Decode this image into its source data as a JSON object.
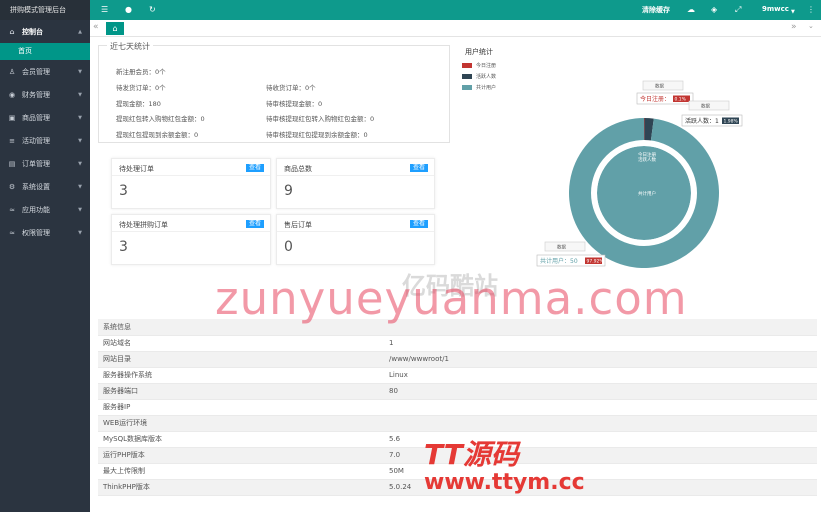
{
  "brand": "拼购模式管理后台",
  "colors": {
    "accent": "#009688",
    "header": "#0e9a8c",
    "sidebar": "#2b3440",
    "button": "#1e9fff"
  },
  "sidebar": {
    "items": [
      {
        "icon": "home-icon",
        "label": "控制台",
        "active": true
      },
      {
        "icon": "user-icon",
        "label": "会员管理"
      },
      {
        "icon": "finance-icon",
        "label": "财务管理"
      },
      {
        "icon": "goods-icon",
        "label": "商品管理"
      },
      {
        "icon": "activity-icon",
        "label": "活动管理"
      },
      {
        "icon": "order-icon",
        "label": "订单管理"
      },
      {
        "icon": "gear-icon",
        "label": "系统设置"
      },
      {
        "icon": "app-icon",
        "label": "应用功能"
      },
      {
        "icon": "permission-icon",
        "label": "权限管理"
      }
    ],
    "sub_active": "首页"
  },
  "header": {
    "clear_cache": "清除缓存",
    "user": "9mwcc"
  },
  "stats": {
    "legend": "近七天统计",
    "new_members": "新注册会员：0个",
    "pending_ship": "待发货订单：0个",
    "pending_receive": "待收货订单：0个",
    "withdraw_amount": "提现金额：180",
    "pending_withdraw": "待审核提现金额：0",
    "withdraw_redbag": "提现红包转入购物红包金额：0",
    "pending_withdraw_redbag": "待审核提现红包转入购物红包金额：0",
    "withdraw_redbag_balance": "提现红包提现到余额金额：0",
    "pending_withdraw_redbag_balance": "待审核提现红包提现到余额金额：0"
  },
  "cards": [
    {
      "title": "待处理订单",
      "btn": "查看",
      "value": "3"
    },
    {
      "title": "商品总数",
      "btn": "查看",
      "value": "9"
    },
    {
      "title": "待处理拼购订单",
      "btn": "查看",
      "value": "3"
    },
    {
      "title": "售后订单",
      "btn": "查看",
      "value": "0"
    }
  ],
  "chart_data": {
    "type": "pie",
    "title": "用户统计",
    "legend_position": "top-left",
    "series": [
      {
        "name": "今日注册",
        "value": 0.1,
        "color": "#c23531"
      },
      {
        "name": "活跃人数",
        "value": 1.98,
        "color": "#2f4554"
      },
      {
        "name": "共计用户",
        "value": 97.92,
        "color": "#61a0a8"
      }
    ],
    "tooltips": [
      {
        "header": "数据",
        "label": "今日注册：",
        "pct": "0.1%"
      },
      {
        "header": "数据",
        "label": "活跃人数：1",
        "pct": "1.98%"
      },
      {
        "header": "数据",
        "label": "共计用户：50",
        "pct": "97.92%"
      }
    ],
    "inner_labels": [
      "今日注册",
      "活跃人数"
    ],
    "center_label": "共计用户"
  },
  "system": {
    "title": "系统信息",
    "rows": [
      {
        "k": "网站域名",
        "v": "1"
      },
      {
        "k": "网站目录",
        "v": "/www/wwwroot/1"
      },
      {
        "k": "服务器操作系统",
        "v": "Linux"
      },
      {
        "k": "服务器端口",
        "v": "80"
      },
      {
        "k": "服务器IP",
        "v": ""
      },
      {
        "k": "WEB运行环境",
        "v": ""
      },
      {
        "k": "MySQL数据库版本",
        "v": "5.6"
      },
      {
        "k": "运行PHP版本",
        "v": "7.0"
      },
      {
        "k": "最大上传限制",
        "v": "50M"
      },
      {
        "k": "ThinkPHP版本",
        "v": "5.0.24"
      }
    ]
  },
  "watermarks": {
    "w1": "zunyueyuanma.com",
    "w2": "亿码酷站",
    "w3": "TT源码",
    "w4": "www.ttym.cc"
  }
}
